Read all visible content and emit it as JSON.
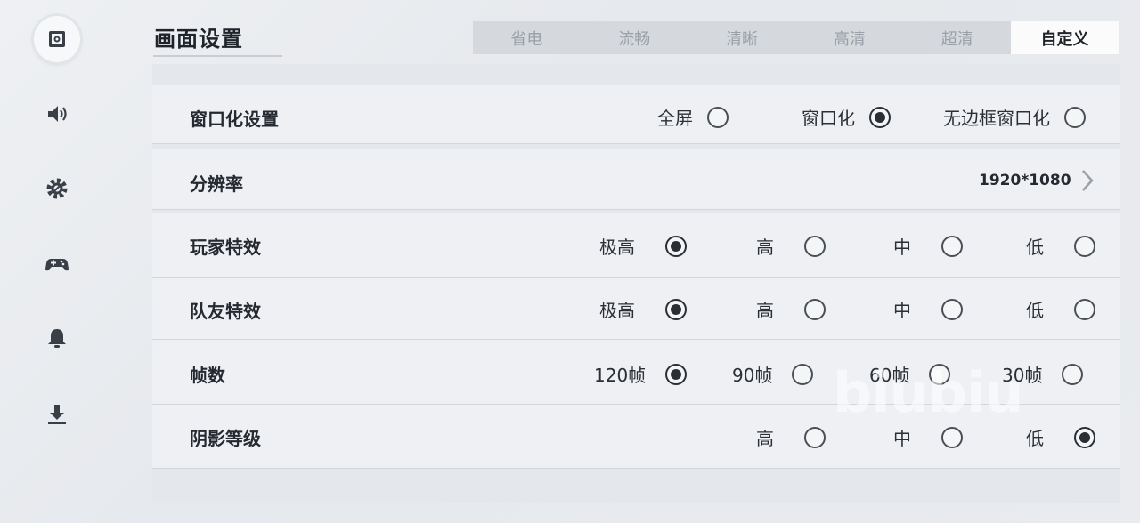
{
  "header": {
    "title": "画面设置"
  },
  "tabs": [
    {
      "label": "省电",
      "active": false
    },
    {
      "label": "流畅",
      "active": false
    },
    {
      "label": "清晰",
      "active": false
    },
    {
      "label": "高清",
      "active": false
    },
    {
      "label": "超清",
      "active": false
    },
    {
      "label": "自定义",
      "active": true
    }
  ],
  "sidebar": {
    "items": [
      {
        "icon": "display-settings-icon",
        "active": true
      },
      {
        "icon": "speaker-icon",
        "active": false
      },
      {
        "icon": "gear-icon",
        "active": false
      },
      {
        "icon": "gamepad-icon",
        "active": false
      },
      {
        "icon": "bell-icon",
        "active": false
      },
      {
        "icon": "download-icon",
        "active": false
      }
    ]
  },
  "settings": {
    "window_mode": {
      "label": "窗口化设置",
      "options": [
        "全屏",
        "窗口化",
        "无边框窗口化"
      ],
      "selected": "窗口化"
    },
    "resolution": {
      "label": "分辨率",
      "value": "1920*1080"
    },
    "player_effects": {
      "label": "玩家特效",
      "options": [
        "极高",
        "高",
        "中",
        "低"
      ],
      "selected": "极高"
    },
    "teammate_effects": {
      "label": "队友特效",
      "options": [
        "极高",
        "高",
        "中",
        "低"
      ],
      "selected": "极高"
    },
    "frame_rate": {
      "label": "帧数",
      "options": [
        "120帧",
        "90帧",
        "60帧",
        "30帧"
      ],
      "selected": "120帧"
    },
    "shadow_level": {
      "label": "阴影等级",
      "options": [
        "高",
        "中",
        "低"
      ],
      "selected": "低"
    }
  },
  "watermark": "biubiu",
  "colors": {
    "accent": "#2a2e35",
    "tab_active_bg": "#fbfbfc",
    "tab_bar_bg": "#d5d9de"
  }
}
